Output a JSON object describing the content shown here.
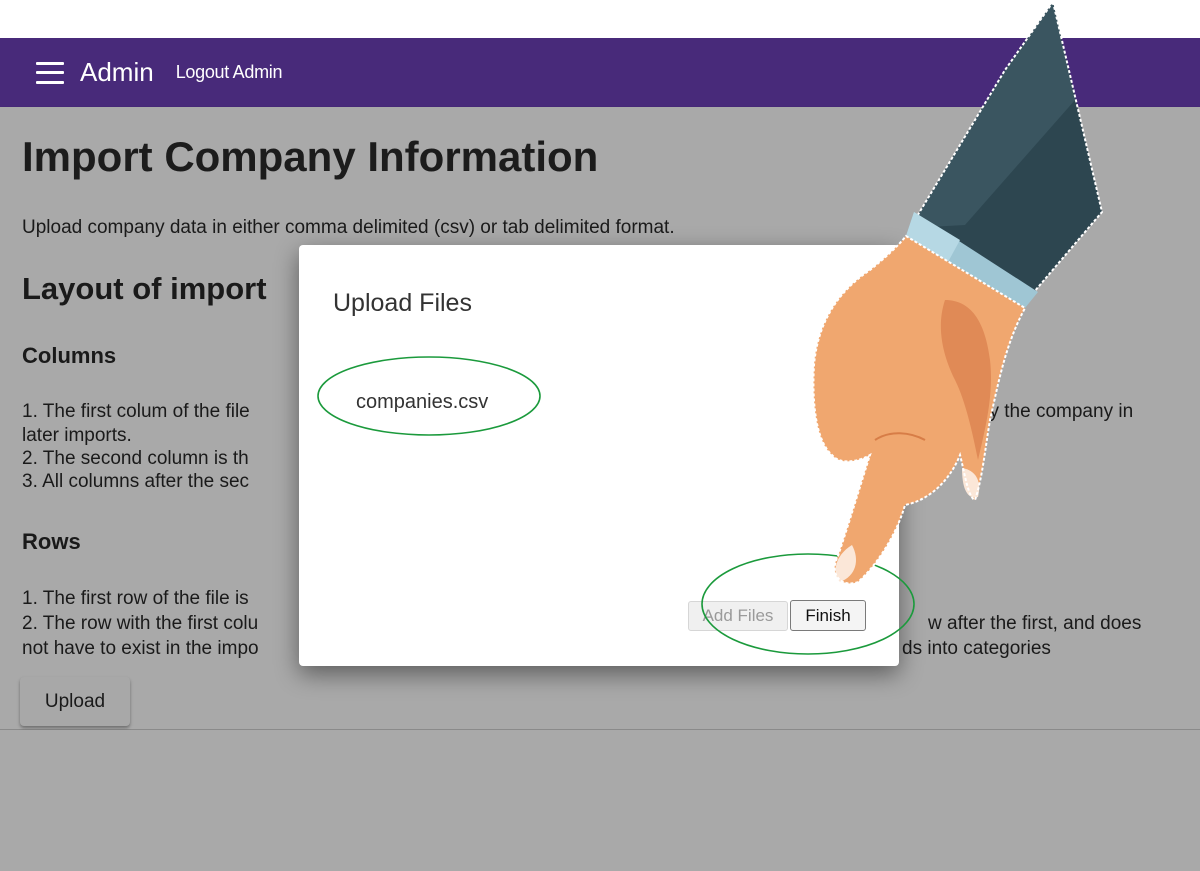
{
  "appbar": {
    "title": "Admin",
    "logout_label": "Logout Admin",
    "menu_icon": "hamburger-menu-icon",
    "color": "#482a7a"
  },
  "page": {
    "title": "Import Company Information",
    "intro": "Upload company data in either comma delimited (csv) or tab delimited format.",
    "layout_heading": "Layout of import",
    "columns_heading": "Columns",
    "columns_lines": [
      "1. The first colum of the file",
      "ify the company in",
      "later imports.",
      "2. The second column is th",
      "3. All columns after the sec"
    ],
    "rows_heading": "Rows",
    "rows_lines": [
      "1. The first row of the file is",
      "2. The row with the first colu",
      "w after the first, and does",
      "not have to exist in the impo",
      "ds into categories"
    ],
    "upload_label": "Upload",
    "background": "#a9a9a9"
  },
  "dialog": {
    "title": "Upload Files",
    "file_name": "companies.csv",
    "add_files_label": "Add Files",
    "finish_label": "Finish"
  },
  "annotations": {
    "highlight_color": "#1b9a3c",
    "pointer": "pointing-hand-illustration"
  }
}
